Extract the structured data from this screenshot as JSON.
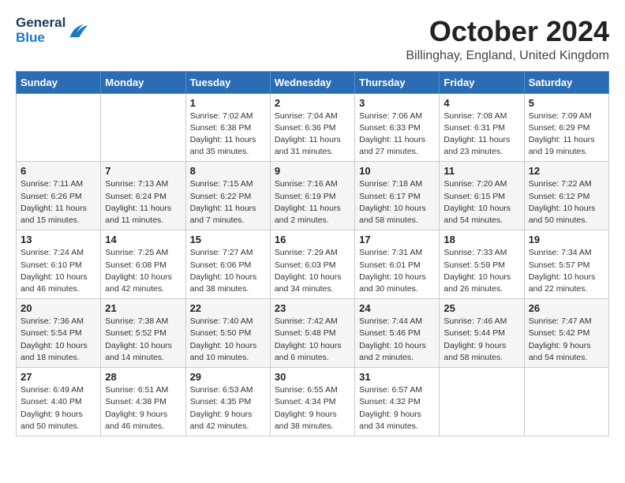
{
  "header": {
    "logo_general": "General",
    "logo_blue": "Blue",
    "month_title": "October 2024",
    "location": "Billinghay, England, United Kingdom"
  },
  "weekdays": [
    "Sunday",
    "Monday",
    "Tuesday",
    "Wednesday",
    "Thursday",
    "Friday",
    "Saturday"
  ],
  "weeks": [
    [
      {
        "day": "",
        "info": ""
      },
      {
        "day": "",
        "info": ""
      },
      {
        "day": "1",
        "info": "Sunrise: 7:02 AM\nSunset: 6:38 PM\nDaylight: 11 hours and 35 minutes."
      },
      {
        "day": "2",
        "info": "Sunrise: 7:04 AM\nSunset: 6:36 PM\nDaylight: 11 hours and 31 minutes."
      },
      {
        "day": "3",
        "info": "Sunrise: 7:06 AM\nSunset: 6:33 PM\nDaylight: 11 hours and 27 minutes."
      },
      {
        "day": "4",
        "info": "Sunrise: 7:08 AM\nSunset: 6:31 PM\nDaylight: 11 hours and 23 minutes."
      },
      {
        "day": "5",
        "info": "Sunrise: 7:09 AM\nSunset: 6:29 PM\nDaylight: 11 hours and 19 minutes."
      }
    ],
    [
      {
        "day": "6",
        "info": "Sunrise: 7:11 AM\nSunset: 6:26 PM\nDaylight: 11 hours and 15 minutes."
      },
      {
        "day": "7",
        "info": "Sunrise: 7:13 AM\nSunset: 6:24 PM\nDaylight: 11 hours and 11 minutes."
      },
      {
        "day": "8",
        "info": "Sunrise: 7:15 AM\nSunset: 6:22 PM\nDaylight: 11 hours and 7 minutes."
      },
      {
        "day": "9",
        "info": "Sunrise: 7:16 AM\nSunset: 6:19 PM\nDaylight: 11 hours and 2 minutes."
      },
      {
        "day": "10",
        "info": "Sunrise: 7:18 AM\nSunset: 6:17 PM\nDaylight: 10 hours and 58 minutes."
      },
      {
        "day": "11",
        "info": "Sunrise: 7:20 AM\nSunset: 6:15 PM\nDaylight: 10 hours and 54 minutes."
      },
      {
        "day": "12",
        "info": "Sunrise: 7:22 AM\nSunset: 6:12 PM\nDaylight: 10 hours and 50 minutes."
      }
    ],
    [
      {
        "day": "13",
        "info": "Sunrise: 7:24 AM\nSunset: 6:10 PM\nDaylight: 10 hours and 46 minutes."
      },
      {
        "day": "14",
        "info": "Sunrise: 7:25 AM\nSunset: 6:08 PM\nDaylight: 10 hours and 42 minutes."
      },
      {
        "day": "15",
        "info": "Sunrise: 7:27 AM\nSunset: 6:06 PM\nDaylight: 10 hours and 38 minutes."
      },
      {
        "day": "16",
        "info": "Sunrise: 7:29 AM\nSunset: 6:03 PM\nDaylight: 10 hours and 34 minutes."
      },
      {
        "day": "17",
        "info": "Sunrise: 7:31 AM\nSunset: 6:01 PM\nDaylight: 10 hours and 30 minutes."
      },
      {
        "day": "18",
        "info": "Sunrise: 7:33 AM\nSunset: 5:59 PM\nDaylight: 10 hours and 26 minutes."
      },
      {
        "day": "19",
        "info": "Sunrise: 7:34 AM\nSunset: 5:57 PM\nDaylight: 10 hours and 22 minutes."
      }
    ],
    [
      {
        "day": "20",
        "info": "Sunrise: 7:36 AM\nSunset: 5:54 PM\nDaylight: 10 hours and 18 minutes."
      },
      {
        "day": "21",
        "info": "Sunrise: 7:38 AM\nSunset: 5:52 PM\nDaylight: 10 hours and 14 minutes."
      },
      {
        "day": "22",
        "info": "Sunrise: 7:40 AM\nSunset: 5:50 PM\nDaylight: 10 hours and 10 minutes."
      },
      {
        "day": "23",
        "info": "Sunrise: 7:42 AM\nSunset: 5:48 PM\nDaylight: 10 hours and 6 minutes."
      },
      {
        "day": "24",
        "info": "Sunrise: 7:44 AM\nSunset: 5:46 PM\nDaylight: 10 hours and 2 minutes."
      },
      {
        "day": "25",
        "info": "Sunrise: 7:46 AM\nSunset: 5:44 PM\nDaylight: 9 hours and 58 minutes."
      },
      {
        "day": "26",
        "info": "Sunrise: 7:47 AM\nSunset: 5:42 PM\nDaylight: 9 hours and 54 minutes."
      }
    ],
    [
      {
        "day": "27",
        "info": "Sunrise: 6:49 AM\nSunset: 4:40 PM\nDaylight: 9 hours and 50 minutes."
      },
      {
        "day": "28",
        "info": "Sunrise: 6:51 AM\nSunset: 4:38 PM\nDaylight: 9 hours and 46 minutes."
      },
      {
        "day": "29",
        "info": "Sunrise: 6:53 AM\nSunset: 4:35 PM\nDaylight: 9 hours and 42 minutes."
      },
      {
        "day": "30",
        "info": "Sunrise: 6:55 AM\nSunset: 4:34 PM\nDaylight: 9 hours and 38 minutes."
      },
      {
        "day": "31",
        "info": "Sunrise: 6:57 AM\nSunset: 4:32 PM\nDaylight: 9 hours and 34 minutes."
      },
      {
        "day": "",
        "info": ""
      },
      {
        "day": "",
        "info": ""
      }
    ]
  ]
}
